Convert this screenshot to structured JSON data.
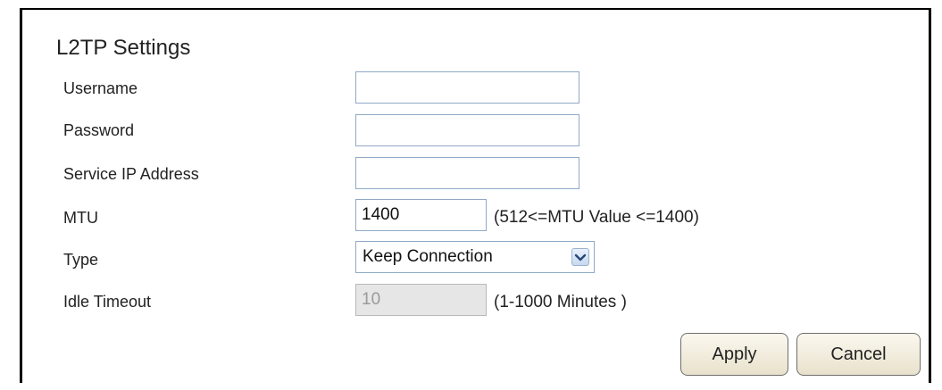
{
  "form": {
    "title": "L2TP Settings",
    "fields": [
      {
        "label": "Username",
        "value": ""
      },
      {
        "label": "Password",
        "value": ""
      },
      {
        "label": "Service IP Address",
        "value": ""
      },
      {
        "label": "MTU",
        "value": "1400",
        "hint": "(512<=MTU Value <=1400)"
      },
      {
        "label": "Type",
        "selected": "Keep Connection"
      },
      {
        "label": "Idle Timeout",
        "value": "10",
        "hint": "(1-1000 Minutes )",
        "disabled": true
      }
    ]
  },
  "buttons": {
    "apply": "Apply",
    "cancel": "Cancel"
  },
  "icons": {
    "select_arrow": "chevron-down-icon"
  },
  "colors": {
    "input_border": "#8fa9c6",
    "disabled_bg": "#e6e6e6",
    "button_bg": "#efe9d8"
  }
}
